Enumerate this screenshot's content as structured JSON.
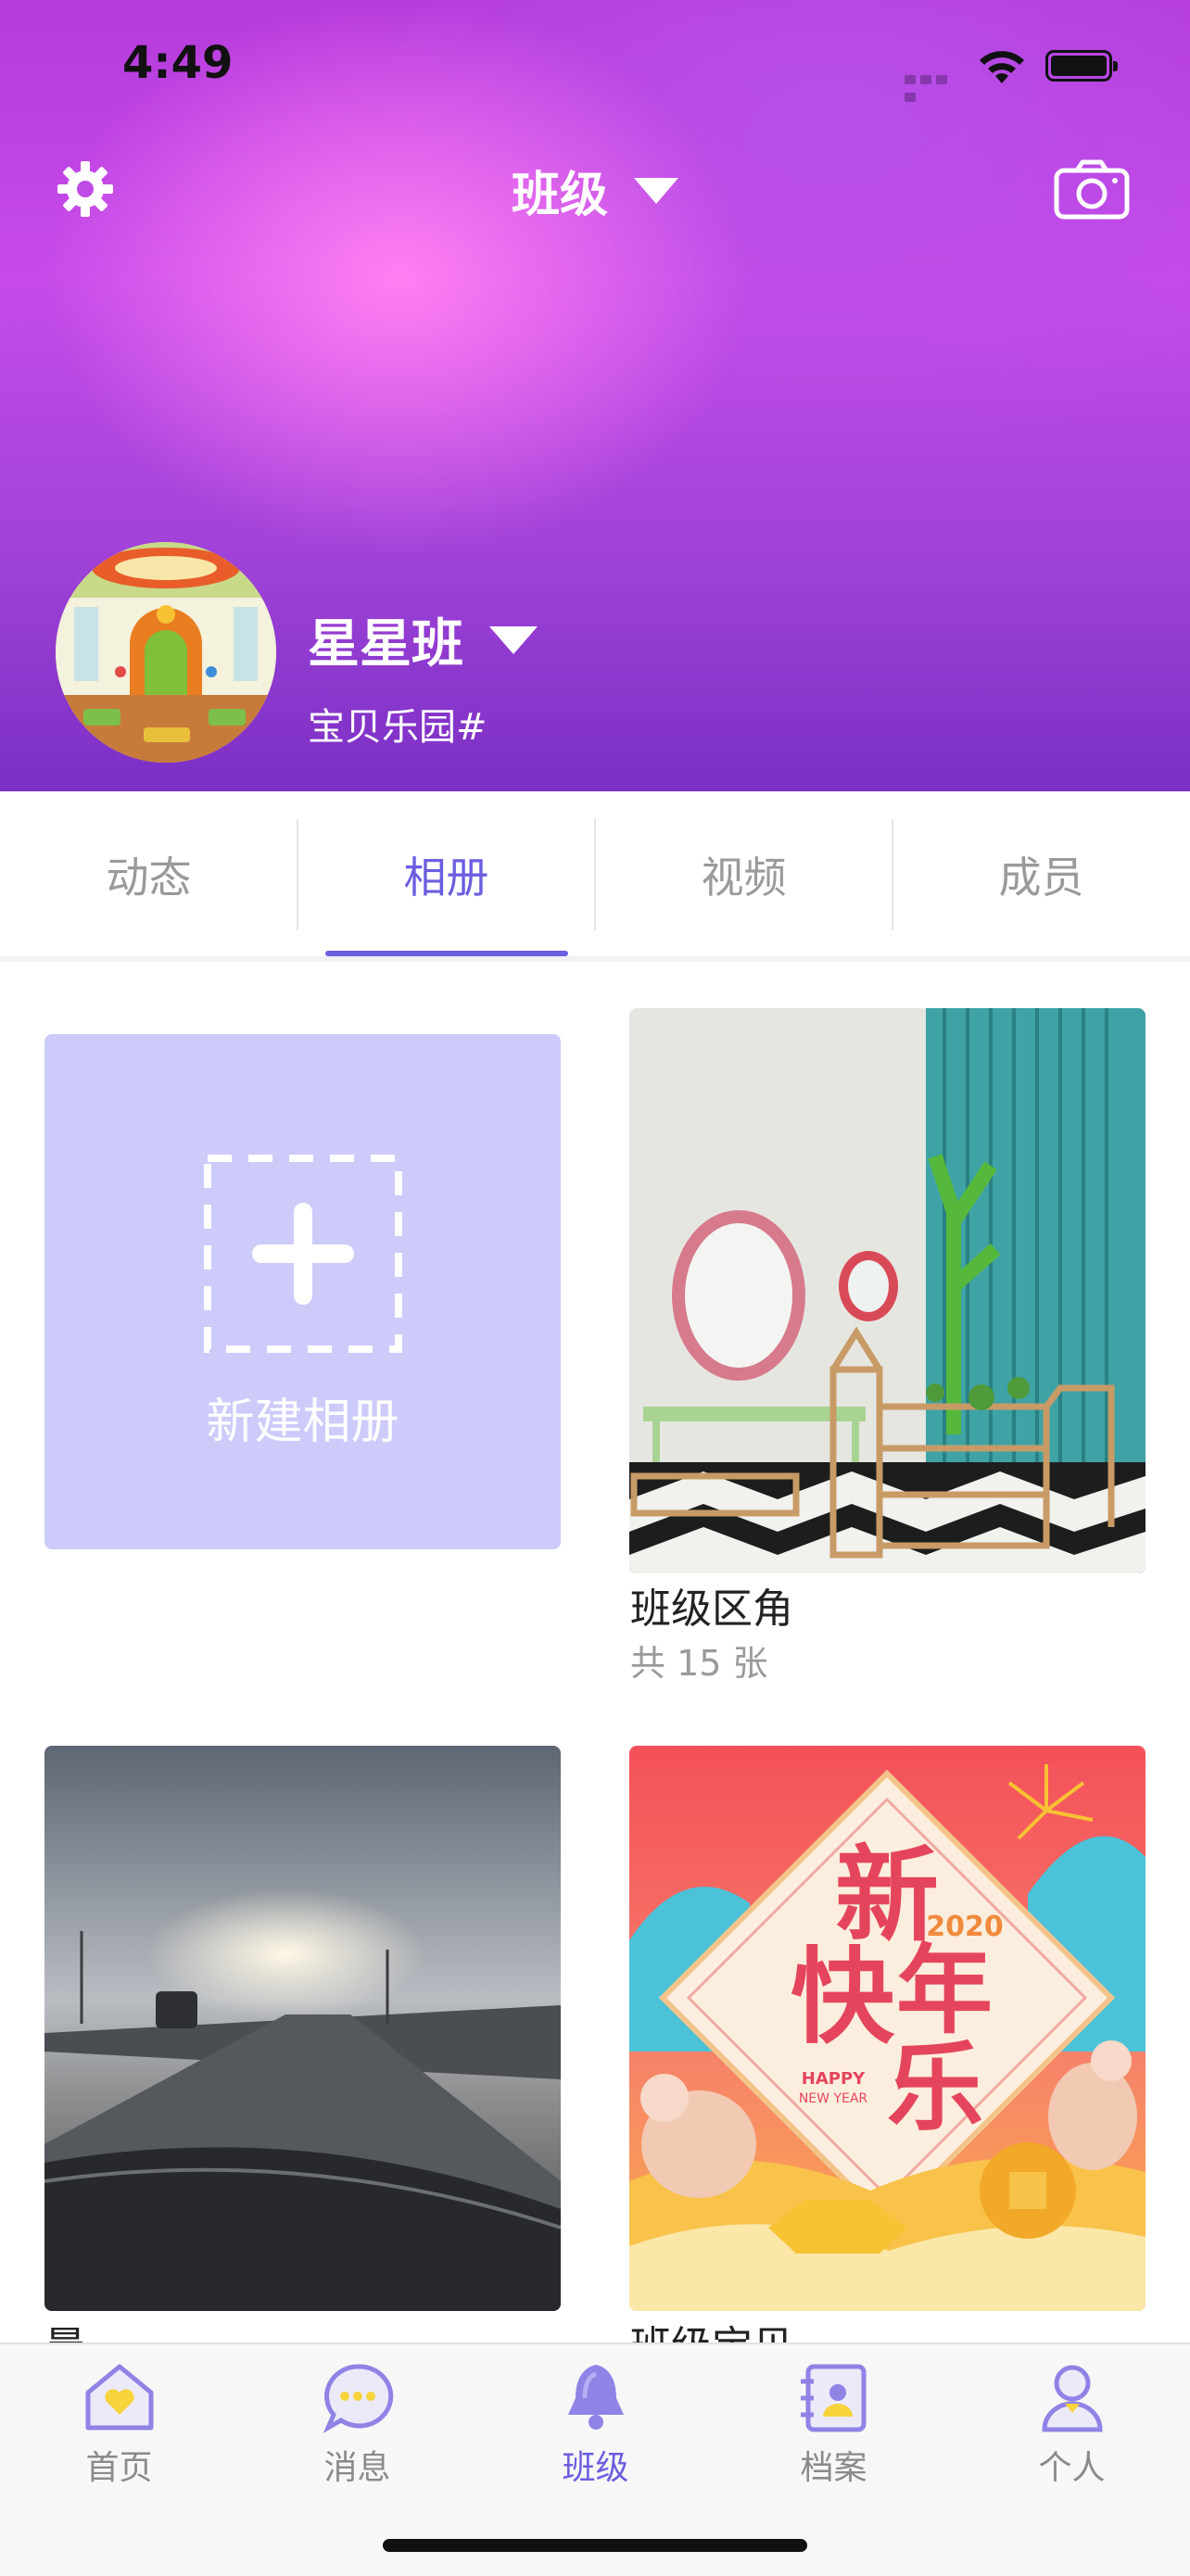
{
  "status_bar": {
    "time": "4:49"
  },
  "header": {
    "title": "班级",
    "class_name": "星星班",
    "school": "宝贝乐园#"
  },
  "tabs": [
    {
      "label": "动态",
      "active": false
    },
    {
      "label": "相册",
      "active": true
    },
    {
      "label": "视频",
      "active": false
    },
    {
      "label": "成员",
      "active": false
    }
  ],
  "new_album": {
    "label": "新建相册"
  },
  "albums": [
    {
      "title": "班级区角",
      "count": "共 15 张"
    },
    {
      "title": "晨",
      "count": ""
    },
    {
      "title": "班级宝贝",
      "count": ""
    }
  ],
  "tab_bar": [
    {
      "label": "首页",
      "icon": "home-icon"
    },
    {
      "label": "消息",
      "icon": "message-icon"
    },
    {
      "label": "班级",
      "icon": "bell-icon",
      "active": true
    },
    {
      "label": "档案",
      "icon": "profile-card-icon"
    },
    {
      "label": "个人",
      "icon": "person-icon"
    }
  ],
  "colors": {
    "accent": "#6b5ee0",
    "new_album_bg": "#cdcbfa",
    "header_purple": "#b53bdc"
  }
}
